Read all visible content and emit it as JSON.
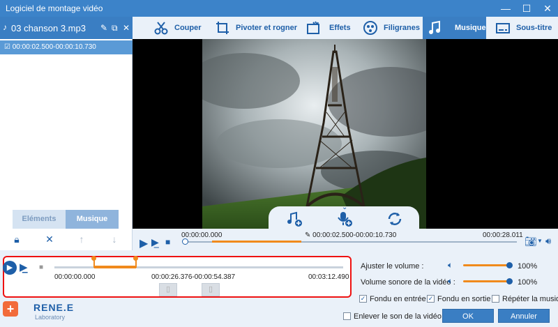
{
  "window": {
    "title": "Logiciel de montage vidéo",
    "minimize": "—",
    "maximize": "☐",
    "close": "✕"
  },
  "file": {
    "name": "03 chanson 3.mp3",
    "segment": "00:00:02.500-00:00:10.730"
  },
  "left_tabs": {
    "elements": "Eléments",
    "music": "Musique"
  },
  "toolbar": {
    "cut": "Couper",
    "rotate": "Pivoter et rogner",
    "effects": "Effets",
    "watermarks": "Filigranes",
    "music": "Musique",
    "subtitles": "Sous-titre"
  },
  "preview_timeline": {
    "start": "00:00:00.000",
    "selection": "00:00:02.500-00:00:10.730",
    "end": "00:00:28.011",
    "selection_start_fraction": 0.082,
    "selection_end_fraction": 0.35
  },
  "audio_timeline": {
    "start": "00:00:00.000",
    "selection": "00:00:26.376-00:00:54.387",
    "end": "00:03:12.490",
    "selection_start_fraction": 0.137,
    "selection_end_fraction": 0.282
  },
  "volume": {
    "label": "Ajuster le volume :",
    "value": "100%",
    "fraction": 1.0
  },
  "video_volume": {
    "label": "Volume sonore de la vidéo :",
    "value": "100%",
    "fraction": 1.0
  },
  "options": {
    "fade_in": "Fondu en entrée",
    "fade_out": "Fondu en sortie",
    "repeat": "Répéter la musique",
    "fade_in_checked": true,
    "fade_out_checked": true,
    "repeat_checked": false
  },
  "remove_sound": {
    "label": "Enlever le son de la vidéo",
    "checked": false
  },
  "buttons": {
    "ok": "OK",
    "cancel": "Annuler"
  },
  "logo": {
    "name": "RENE.E",
    "sub": "Laboratory"
  },
  "colors": {
    "accent": "#3a7ec3",
    "orange": "#f08a1c",
    "highlight": "#e11111"
  }
}
